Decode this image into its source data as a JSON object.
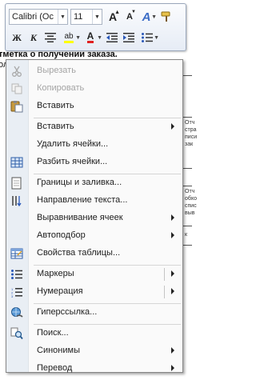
{
  "toolbar": {
    "font_name": "Calibri (Ос",
    "font_size": "11",
    "grow_font": "A",
    "shrink_font": "A",
    "style_glyph": "A",
    "bold": "Ж",
    "italic": "К",
    "highlight": "ab",
    "font_color": "A"
  },
  "document": {
    "line1": "тметка о получении заказа.",
    "line2": "ол",
    "cells": [
      "Отч",
      "стра",
      "писи",
      "зак",
      "Отч",
      "обхо",
      "спис",
      "выв",
      "к"
    ]
  },
  "menu": {
    "items": [
      {
        "label": "Вырезать",
        "icon": "scissors-icon",
        "disabled": true
      },
      {
        "label": "Копировать",
        "icon": "copy-icon",
        "disabled": true
      },
      {
        "label": "Вставить",
        "icon": "paste-icon",
        "disabled": false
      },
      {
        "label": "Вставить",
        "icon": "",
        "disabled": false,
        "submenu": true
      },
      {
        "label": "Удалить ячейки...",
        "icon": "",
        "disabled": false
      },
      {
        "label": "Разбить ячейки...",
        "icon": "split-cells-icon",
        "disabled": false
      },
      {
        "label": "Границы и заливка...",
        "icon": "borders-icon",
        "disabled": false
      },
      {
        "label": "Направление текста...",
        "icon": "text-direction-icon",
        "disabled": false
      },
      {
        "label": "Выравнивание ячеек",
        "icon": "",
        "disabled": false,
        "submenu": true
      },
      {
        "label": "Автоподбор",
        "icon": "",
        "disabled": false,
        "submenu": true
      },
      {
        "label": "Свойства таблицы...",
        "icon": "table-properties-icon",
        "disabled": false
      },
      {
        "label": "Маркеры",
        "icon": "bullets-icon",
        "disabled": false,
        "submenu": true
      },
      {
        "label": "Нумерация",
        "icon": "numbering-icon",
        "disabled": false,
        "submenu": true
      },
      {
        "label": "Гиперссылка...",
        "icon": "hyperlink-icon",
        "disabled": false
      },
      {
        "label": "Поиск...",
        "icon": "search-icon",
        "disabled": false
      },
      {
        "label": "Синонимы",
        "icon": "",
        "disabled": false,
        "submenu": true
      },
      {
        "label": "Перевод",
        "icon": "",
        "disabled": false,
        "submenu": true
      }
    ]
  },
  "colors": {
    "font_color_underline": "#e02020",
    "highlight_underline": "#ffff00"
  }
}
